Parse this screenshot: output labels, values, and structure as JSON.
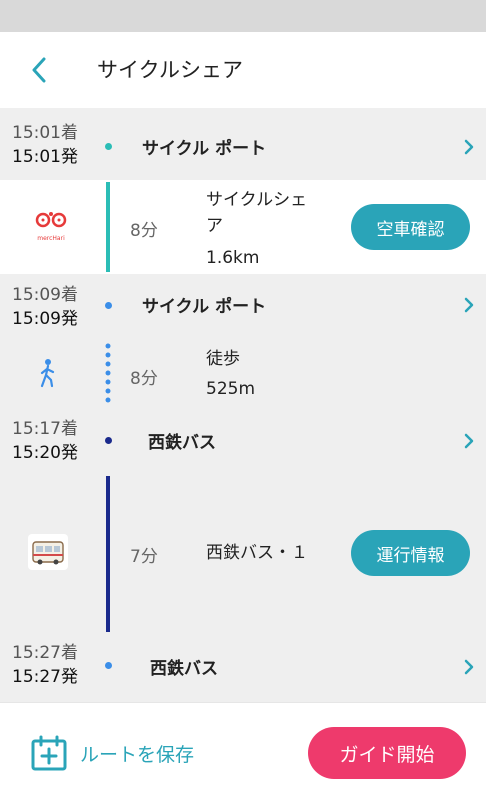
{
  "header": {
    "title": "サイクルシェア"
  },
  "stops": [
    {
      "arrive": "15:01着",
      "depart": "15:01発",
      "name": "サイクル ポート"
    },
    {
      "arrive": "15:09着",
      "depart": "15:09発",
      "name": "サイクル ポート"
    },
    {
      "arrive": "15:17着",
      "depart": "15:20発",
      "name": "西鉄バス"
    },
    {
      "arrive": "15:27着",
      "depart": "15:27発",
      "name": "西鉄バス"
    }
  ],
  "segments": [
    {
      "duration": "8分",
      "name_line1": "サイクルシェ",
      "name_line2": "ア",
      "distance": "1.6km",
      "button": "空車確認",
      "logo_text": "mercHari"
    },
    {
      "duration": "8分",
      "name": "徒歩",
      "distance": "525m"
    },
    {
      "duration": "7分",
      "name": "西鉄バス・１",
      "button": "運行情報"
    }
  ],
  "footer": {
    "save_label": "ルートを保存",
    "guide_label": "ガイド開始"
  },
  "colors": {
    "accent": "#2aa4b8",
    "bike_line": "#2bbdb6",
    "walk_dots": "#3b8ee8",
    "bus_line": "#1a2a8c",
    "guide": "#ee3a6c"
  }
}
